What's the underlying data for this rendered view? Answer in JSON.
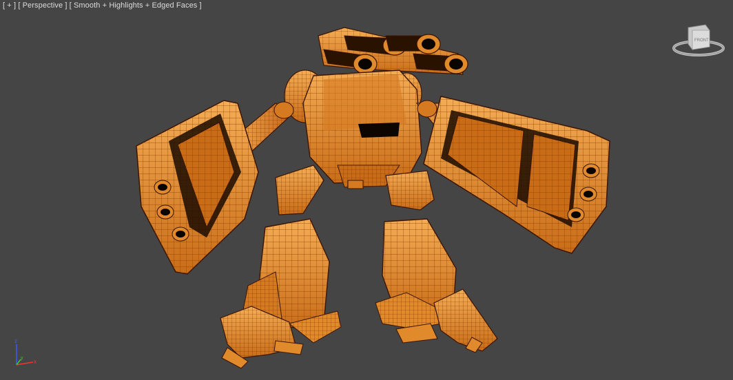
{
  "viewport": {
    "label_plus": "[ + ]",
    "label_view": "[ Perspective ]",
    "label_shading": "[ Smooth + Highlights + Edged Faces ]"
  },
  "viewcube": {
    "face_label": "FRONT"
  },
  "axis": {
    "z": "z",
    "x": "x",
    "y": "y"
  },
  "colors": {
    "background": "#454545",
    "model_fill": "#e08a2c",
    "model_light": "#f0a850",
    "wire": "#8a3e00",
    "wire_dark": "#3a1400",
    "shadow": "#1a0a00"
  },
  "icons": {
    "viewcube": "viewcube-icon",
    "axis": "axis-tripod-icon"
  }
}
